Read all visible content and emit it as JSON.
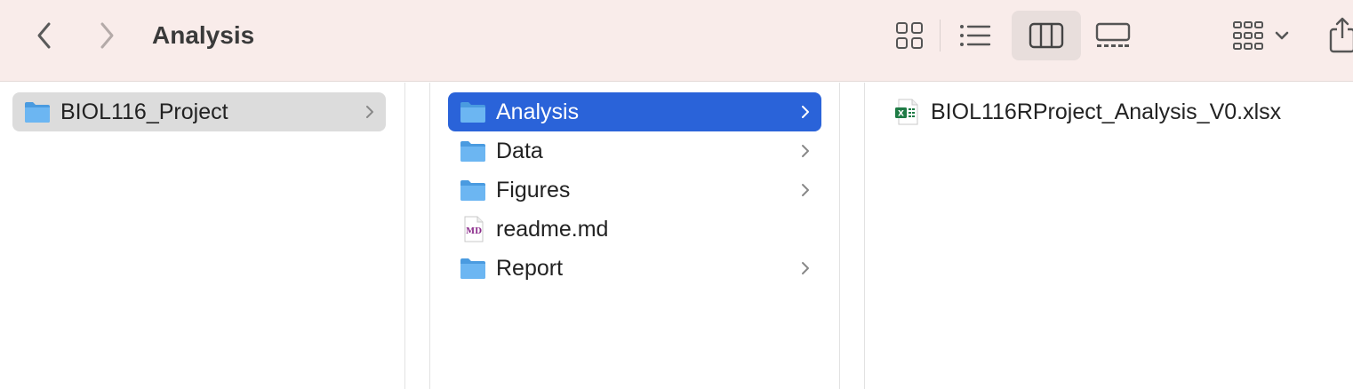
{
  "toolbar": {
    "title": "Analysis",
    "back_icon": "chevron-left-icon",
    "forward_icon": "chevron-right-icon",
    "view_icons": [
      "icon-view-icon",
      "list-view-icon",
      "column-view-icon",
      "gallery-view-icon",
      "group-icon",
      "share-icon"
    ]
  },
  "columns": {
    "col1": [
      {
        "label": "BIOL116_Project",
        "type": "folder",
        "selected": true,
        "has_children": true
      }
    ],
    "col2": [
      {
        "label": "Analysis",
        "type": "folder",
        "selected": true,
        "has_children": true
      },
      {
        "label": "Data",
        "type": "folder",
        "selected": false,
        "has_children": true
      },
      {
        "label": "Figures",
        "type": "folder",
        "selected": false,
        "has_children": true
      },
      {
        "label": "readme.md",
        "type": "markdown",
        "icon_text": "MD",
        "selected": false,
        "has_children": false
      },
      {
        "label": "Report",
        "type": "folder",
        "selected": false,
        "has_children": true
      }
    ],
    "col3": [
      {
        "label": "BIOL116RProject_Analysis_V0.xlsx",
        "type": "excel",
        "selected": false,
        "has_children": false
      }
    ]
  },
  "colors": {
    "toolbar_bg": "#f9ecea",
    "selection_blue": "#2a63d9",
    "selection_grey": "#dcdcdc",
    "folder_blue": "#5aaef0",
    "excel_green": "#1e7b45"
  }
}
